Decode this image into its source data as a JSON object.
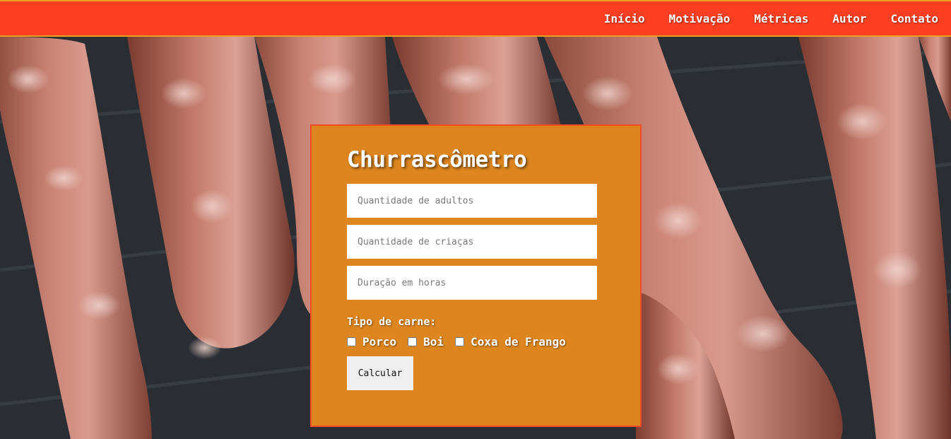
{
  "nav": {
    "items": [
      {
        "label": "Início"
      },
      {
        "label": "Motivação"
      },
      {
        "label": "Métricas"
      },
      {
        "label": "Autor"
      },
      {
        "label": "Contato"
      }
    ]
  },
  "hero": {
    "background_image": "grilled-sausages-photo"
  },
  "calculator": {
    "title": "Churrascômetro",
    "inputs": {
      "adults": {
        "placeholder": "Quantidade de adultos",
        "value": ""
      },
      "children": {
        "placeholder": "Quantidade de criaças",
        "value": ""
      },
      "duration": {
        "placeholder": "Duração em horas",
        "value": ""
      }
    },
    "meat_type_label": "Tipo de carne:",
    "meat_options": [
      {
        "label": "Porco",
        "checked": false
      },
      {
        "label": "Boi",
        "checked": false
      },
      {
        "label": "Coxa de Frango",
        "checked": false
      }
    ],
    "calculate_label": "Calcular"
  },
  "colors": {
    "navbar": "#fc3f22",
    "navbar_border": "#f0a020",
    "card": "#dd861f",
    "card_border": "#f24a25"
  }
}
